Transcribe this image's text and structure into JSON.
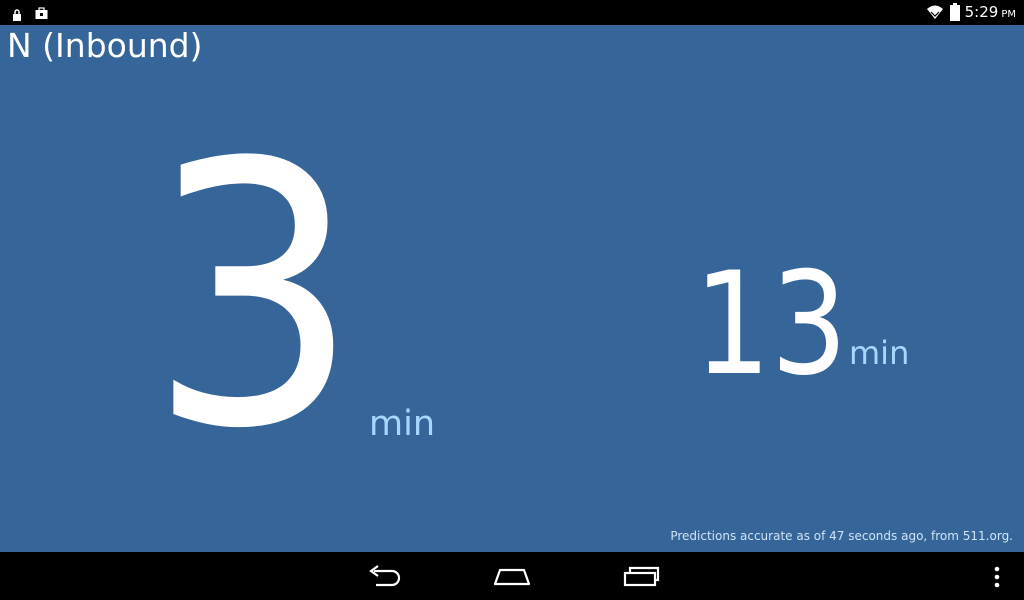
{
  "status_bar": {
    "time": "5:29",
    "ampm": "PM",
    "icons": [
      "lock-icon",
      "briefcase-icon",
      "wifi-icon",
      "battery-icon"
    ]
  },
  "route": {
    "title": "N (Inbound)"
  },
  "predictions": [
    {
      "value": "3",
      "unit": "min"
    },
    {
      "value": "13",
      "unit": "min"
    }
  ],
  "footer": {
    "note": "Predictions accurate as of 47 seconds ago, from 511.org."
  },
  "nav_bar": {
    "icons": [
      "back-icon",
      "home-icon",
      "recent-apps-icon",
      "overflow-menu-icon"
    ]
  },
  "colors": {
    "background": "#366699",
    "unit_text": "#a7d7ff",
    "status_bar": "#000000"
  }
}
